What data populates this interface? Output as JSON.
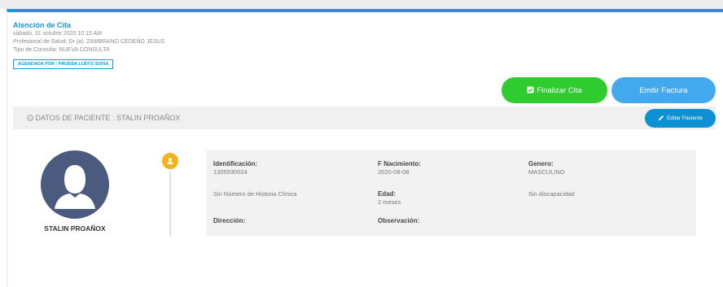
{
  "appointment": {
    "title": "Atención de Cita",
    "datetime": "sábado, 31 octubre 2020 10:15 AM",
    "professional": "Profesional de Salud: Dr (a). ZAMBRANO CEDEÑO JESUS",
    "consult_type": "Tipo de Consulta: NUEVA CONSULTA",
    "scheduled_by": "AGENDADA POR : PRUEBA LUDYS SOFIA"
  },
  "actions": {
    "finalizar_label": "Finalizar Cita",
    "emitir_label": "Emitir Factura",
    "editar_label": "Editar Paciente"
  },
  "patient_bar": {
    "label": "DATOS DE PACIENTE : STALIN PROAÑOX"
  },
  "patient": {
    "name": "STALIN PROAÑOX",
    "identificacion_label": "Identificación:",
    "identificacion": "1305930024",
    "nacimiento_label": "F Nacimiento:",
    "nacimiento": "2020-08-08",
    "genero_label": "Genero:",
    "genero": "MASCULINO",
    "historia": "Sin Número de Historia Clínica",
    "edad_label": "Edad:",
    "edad": "2 meses",
    "discapacidad": "Sin discapacidad",
    "direccion_label": "Dirección:",
    "observacion_label": "Observación:"
  },
  "colors": {
    "accent": "#1a98d5",
    "finalizar": "#2fcc2f",
    "emitir": "#43a9ef",
    "timeline_dot": "#f5b21f",
    "avatar_bg": "#4b5a7f"
  },
  "icons": [
    "check-square-icon",
    "info-circle-icon",
    "pencil-icon",
    "user-icon",
    "avatar-silhouette-icon"
  ]
}
